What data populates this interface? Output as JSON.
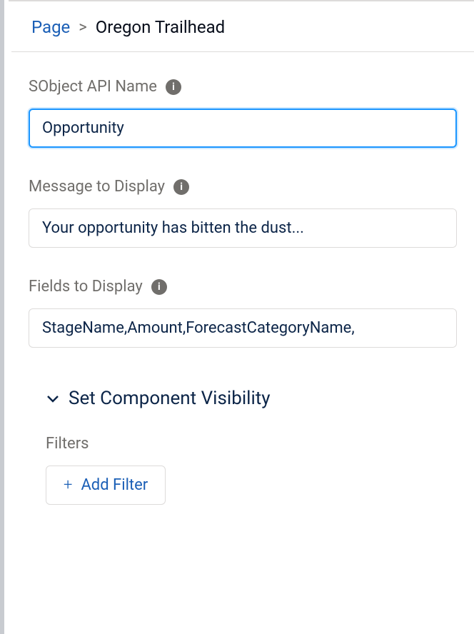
{
  "breadcrumb": {
    "link": "Page",
    "separator": ">",
    "current": "Oregon Trailhead"
  },
  "fields": {
    "sobject": {
      "label": "SObject API Name",
      "value": "Opportunity"
    },
    "message": {
      "label": "Message to Display",
      "value": "Your opportunity has bitten the dust..."
    },
    "fieldsToDisplay": {
      "label": "Fields to Display",
      "value": "StageName,Amount,ForecastCategoryName,"
    }
  },
  "visibility": {
    "sectionTitle": "Set Component Visibility",
    "filtersLabel": "Filters",
    "addFilterLabel": "Add Filter"
  }
}
